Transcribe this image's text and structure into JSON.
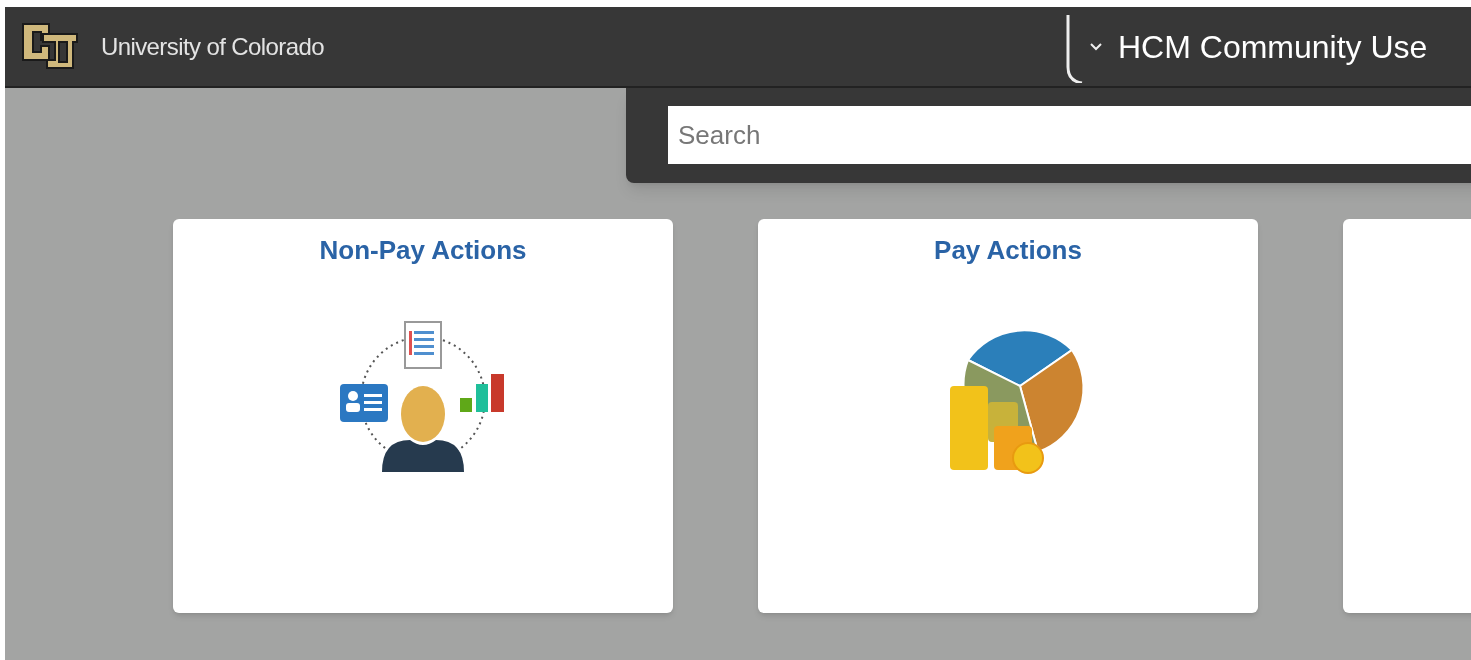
{
  "header": {
    "brand": "University of Colorado",
    "page_title": "HCM Community Use"
  },
  "search": {
    "placeholder": "Search"
  },
  "tiles": [
    {
      "title": "Non-Pay Actions",
      "kind": "people"
    },
    {
      "title": "Pay Actions",
      "kind": "pay"
    },
    {
      "kind": "blank"
    }
  ]
}
